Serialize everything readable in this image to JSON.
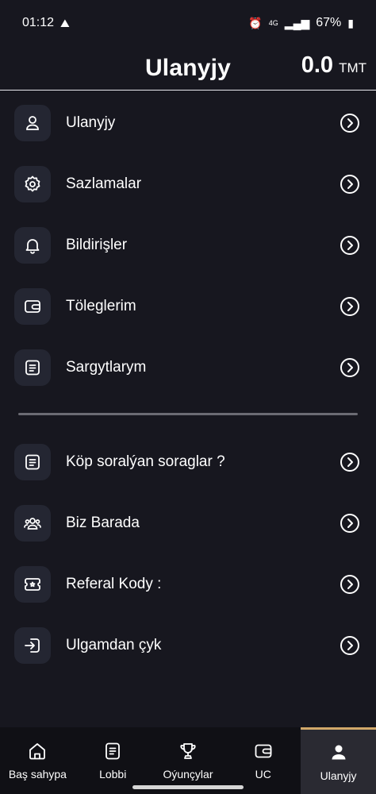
{
  "status_bar": {
    "time": "01:12",
    "network": "4G",
    "battery": "67%"
  },
  "header": {
    "title": "Ulanyjy",
    "balance_value": "0.0",
    "balance_unit": "TMT"
  },
  "menu_primary": [
    {
      "label": "Ulanyjy",
      "icon": "user-icon"
    },
    {
      "label": "Sazlamalar",
      "icon": "gear-icon"
    },
    {
      "label": "Bildirişler",
      "icon": "bell-icon"
    },
    {
      "label": "Töleglerim",
      "icon": "wallet-icon"
    },
    {
      "label": "Sargytlarym",
      "icon": "document-icon"
    }
  ],
  "menu_secondary": [
    {
      "label": "Köp soralýan soraglar ?",
      "icon": "document-icon"
    },
    {
      "label": "Biz Barada",
      "icon": "users-group-icon"
    },
    {
      "label": "Referal Kody :",
      "icon": "ticket-icon"
    },
    {
      "label": "Ulgamdan çyk",
      "icon": "logout-icon"
    }
  ],
  "bottom_nav": [
    {
      "label": "Baş sahypa",
      "icon": "home-icon"
    },
    {
      "label": "Lobbi",
      "icon": "document-icon"
    },
    {
      "label": "Oýunçylar",
      "icon": "trophy-icon"
    },
    {
      "label": "UC",
      "icon": "wallet-icon"
    },
    {
      "label": "Ulanyjy",
      "icon": "user-filled-icon",
      "active": true
    }
  ],
  "colors": {
    "background": "#17171f",
    "icon_box": "#242632",
    "accent": "#d1a86a",
    "divider": "#6b6b73"
  }
}
